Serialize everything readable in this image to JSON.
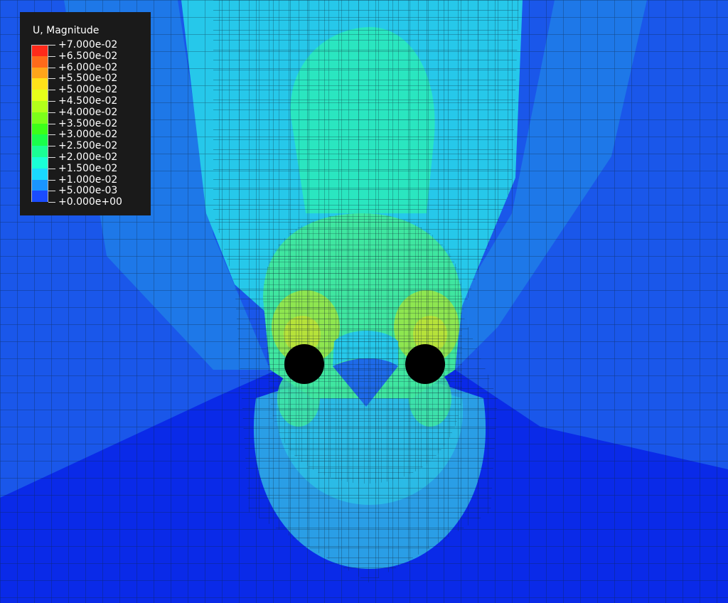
{
  "legend": {
    "title": "U, Magnitude",
    "labels": [
      "+7.000e-02",
      "+6.500e-02",
      "+6.000e-02",
      "+5.500e-02",
      "+5.000e-02",
      "+4.500e-02",
      "+4.000e-02",
      "+3.500e-02",
      "+3.000e-02",
      "+2.500e-02",
      "+2.000e-02",
      "+1.500e-02",
      "+1.000e-02",
      "+5.000e-03",
      "+0.000e+00"
    ],
    "colors": [
      "#ff2a1a",
      "#ff6a1a",
      "#ffa51a",
      "#ffe11a",
      "#e6ff1a",
      "#b3ff1a",
      "#7cff1a",
      "#3cff1a",
      "#1aff4c",
      "#1aff95",
      "#1affd6",
      "#1ad9ff",
      "#1a95ff",
      "#1a4cff"
    ]
  },
  "field": {
    "band_colors": [
      "#0a2ae8",
      "#1a57ea",
      "#1e8ae8",
      "#26c8ea",
      "#2ae6c0",
      "#52e87a",
      "#8ee650",
      "#b6e23a"
    ],
    "hole_color": "#000000",
    "mesh_line_color": "#0d2030"
  }
}
